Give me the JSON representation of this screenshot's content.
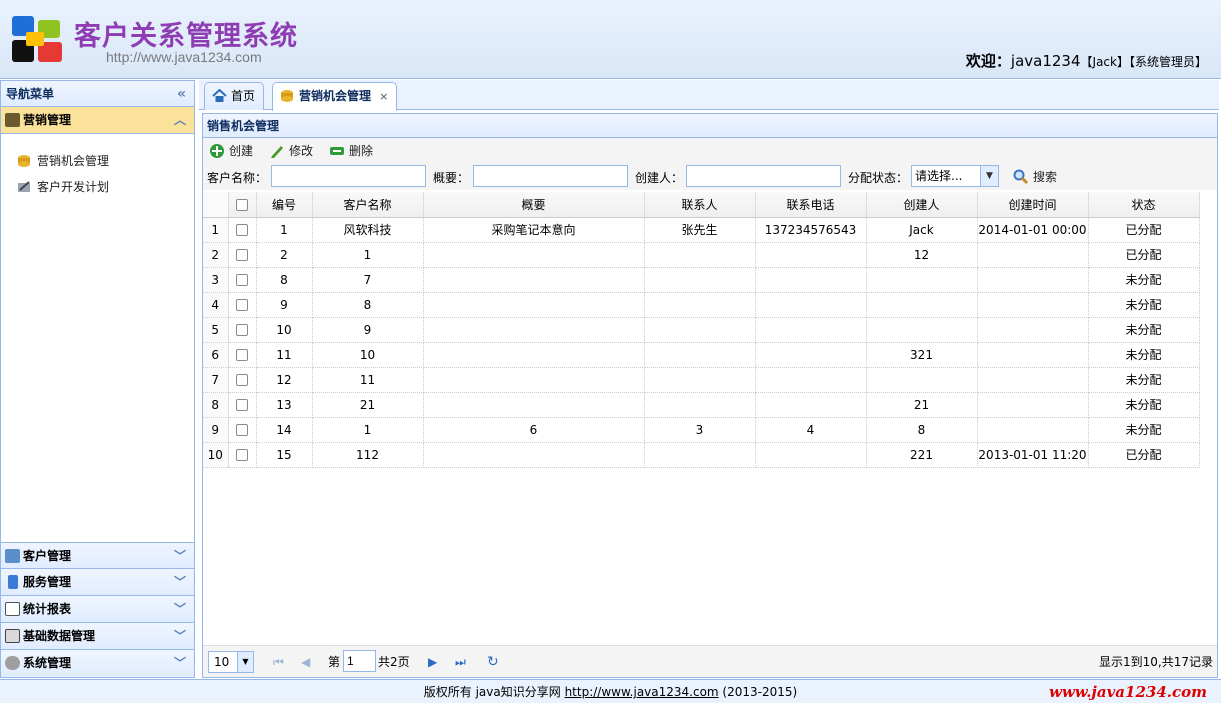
{
  "header": {
    "app_title": "客户关系管理系统",
    "app_url": "http://www.java1234.com",
    "welcome_prefix": "欢迎：",
    "username": "java1234",
    "real_name": "【Jack】",
    "role": "【系统管理员】"
  },
  "nav": {
    "title": "导航菜单",
    "active_group": "营销管理",
    "items": [
      "营销机会管理",
      "客户开发计划"
    ],
    "groups": [
      "客户管理",
      "服务管理",
      "统计报表",
      "基础数据管理",
      "系统管理"
    ]
  },
  "tabs": [
    {
      "label": "首页"
    },
    {
      "label": "营销机会管理",
      "close": "×"
    }
  ],
  "panel": {
    "title": "销售机会管理",
    "toolbar": {
      "create": "创建",
      "edit": "修改",
      "delete": "删除"
    },
    "search": {
      "customer_label": "客户名称：",
      "summary_label": "概要：",
      "creator_label": "创建人：",
      "status_label": "分配状态：",
      "status_value": "请选择...",
      "search_button": "搜索"
    }
  },
  "grid": {
    "columns": [
      "编号",
      "客户名称",
      "概要",
      "联系人",
      "联系电话",
      "创建人",
      "创建时间",
      "状态"
    ],
    "rows": [
      {
        "rn": "1",
        "id": "1",
        "customer": "风软科技",
        "summary": "采购笔记本意向",
        "contact": "张先生",
        "phone": "137234576543",
        "creator": "Jack",
        "time": "2014-01-01 00:00",
        "status": "已分配"
      },
      {
        "rn": "2",
        "id": "2",
        "customer": "1",
        "summary": "",
        "contact": "",
        "phone": "",
        "creator": "12",
        "time": "",
        "status": "已分配"
      },
      {
        "rn": "3",
        "id": "8",
        "customer": "7",
        "summary": "",
        "contact": "",
        "phone": "",
        "creator": "",
        "time": "",
        "status": "未分配"
      },
      {
        "rn": "4",
        "id": "9",
        "customer": "8",
        "summary": "",
        "contact": "",
        "phone": "",
        "creator": "",
        "time": "",
        "status": "未分配"
      },
      {
        "rn": "5",
        "id": "10",
        "customer": "9",
        "summary": "",
        "contact": "",
        "phone": "",
        "creator": "",
        "time": "",
        "status": "未分配"
      },
      {
        "rn": "6",
        "id": "11",
        "customer": "10",
        "summary": "",
        "contact": "",
        "phone": "",
        "creator": "321",
        "time": "",
        "status": "未分配"
      },
      {
        "rn": "7",
        "id": "12",
        "customer": "11",
        "summary": "",
        "contact": "",
        "phone": "",
        "creator": "",
        "time": "",
        "status": "未分配"
      },
      {
        "rn": "8",
        "id": "13",
        "customer": "21",
        "summary": "",
        "contact": "",
        "phone": "",
        "creator": "21",
        "time": "",
        "status": "未分配"
      },
      {
        "rn": "9",
        "id": "14",
        "customer": "1",
        "summary": "6",
        "contact": "3",
        "phone": "4",
        "creator": "8",
        "time": "",
        "status": "未分配"
      },
      {
        "rn": "10",
        "id": "15",
        "customer": "112",
        "summary": "",
        "contact": "",
        "phone": "",
        "creator": "221",
        "time": "2013-01-01 11:20",
        "status": "已分配"
      }
    ]
  },
  "pager": {
    "page_size": "10",
    "page_prefix": "第",
    "page_value": "1",
    "page_suffix": "共2页",
    "summary": "显示1到10,共17记录"
  },
  "footer": {
    "text": "版权所有 java知识分享网 ",
    "link": "http://www.java1234.com",
    "years": " (2013-2015)",
    "watermark": "www.java1234.com"
  }
}
